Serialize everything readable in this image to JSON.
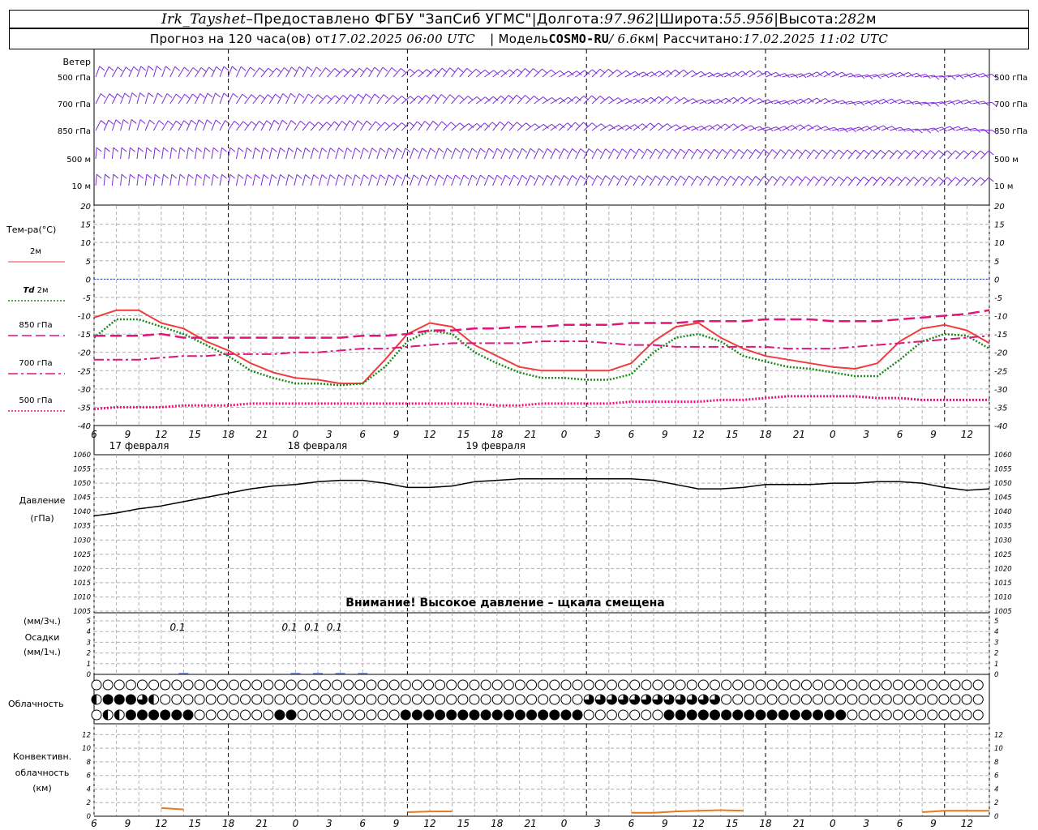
{
  "header": {
    "station": "Irk_Tayshet",
    "dash": " – ",
    "provided": "Предоставлено ФГБУ \"ЗапСиб УГМС\"",
    "sep": " | ",
    "lon_label": "Долгота: ",
    "lon": "97.962",
    "lat_label": "Широта: ",
    "lat": "55.956",
    "alt_label": "Высота: ",
    "alt": "282",
    "alt_unit": "м",
    "forecast_prefix": "Прогноз на 120 часа(ов)  от ",
    "forecast_time": "17.02.2025 06:00 UTC",
    "model_label": "| Модель ",
    "model_name": "COSMO-RU",
    "model_res": " / 6.6",
    "model_res_unit": "км",
    "calc_label": " | Рассчитано: ",
    "calc_time": "17.02.2025 11:02 UTC"
  },
  "wind_panel": {
    "title": "Ветер",
    "levels": [
      "500 гПа",
      "700 гПа",
      "850 гПа",
      "500 м",
      "10 м"
    ],
    "color": "#7a2ad8"
  },
  "temp_panel": {
    "title": "Тем-ра(°C)",
    "legend": [
      {
        "label": "2м",
        "color": "#f03c3c",
        "style": "solid"
      },
      {
        "label_italic": "Td",
        "label": " 2м",
        "color": "#1a8a1a",
        "style": "dotted"
      },
      {
        "label": "850 гПа",
        "color": "#e0147a",
        "style": "dashed"
      },
      {
        "label": "700 гПа",
        "color": "#e0147a",
        "style": "dashdot"
      },
      {
        "label": "500 гПа",
        "color": "#e0147a",
        "style": "dot"
      }
    ],
    "y_ticks": [
      "20",
      "15",
      "10",
      "5",
      "0",
      "-5",
      "-10",
      "-15",
      "-20",
      "-25",
      "-30",
      "-35",
      "-40"
    ],
    "zero_color": "#1f3fd0"
  },
  "time_axis": {
    "hour_labels": [
      "6",
      "9",
      "12",
      "15",
      "18",
      "21",
      "0",
      "3",
      "6",
      "9",
      "12",
      "15",
      "18",
      "21",
      "0",
      "3",
      "6",
      "9",
      "12",
      "15",
      "18",
      "21",
      "0",
      "3",
      "6",
      "9",
      "12"
    ],
    "day_labels": [
      "17 февраля",
      "18 февраля",
      "19 февраля"
    ]
  },
  "pressure_panel": {
    "title": "Давление",
    "unit": "(гПа)",
    "y_ticks": [
      "1060",
      "1055",
      "1050",
      "1045",
      "1040",
      "1035",
      "1030",
      "1025",
      "1020",
      "1015",
      "1010",
      "1005"
    ],
    "warning": "Внимание! Высокое давление – щкала смещена"
  },
  "precip_panel": {
    "unit3": "(мм/3ч.)",
    "title": "Осадки",
    "unit1": "(мм/1ч.)",
    "y_ticks": [
      "5",
      "4",
      "3",
      "2",
      "1",
      "0"
    ],
    "labels": [
      {
        "hour": 12,
        "text": "0.1"
      },
      {
        "hour": 27,
        "text": "0.1"
      },
      {
        "hour": 30,
        "text": "0.1"
      },
      {
        "hour": 33,
        "text": "0.1"
      }
    ]
  },
  "cloud_panel": {
    "title": "Облачность",
    "upper": "000000000000000000000000000000000000000000000000000000000000000000000000000000",
    "middle": "2444320000000000000000000000000000000000000333333333333000000000000000000000000",
    "lower": "0224444440000000440000000004444444444444444000000044444444444444440000000"
  },
  "conv_panel": {
    "title1": "Конвективн.",
    "title2": "облачность",
    "unit": "(км)",
    "y_ticks": [
      "12",
      "10",
      "8",
      "6",
      "4",
      "2",
      "0"
    ],
    "color": "#e87a1a"
  },
  "chart_data": [
    {
      "type": "line",
      "title": "Тем-ра(°C)",
      "x_unit": "hours from 17.02 06 UTC",
      "ylim": [
        -40,
        20
      ],
      "x": [
        0,
        3,
        6,
        9,
        12,
        15,
        18,
        21,
        24,
        27,
        30,
        33,
        36,
        39,
        42,
        45,
        48,
        51,
        54,
        57,
        60,
        63,
        66,
        69,
        72,
        75,
        78,
        81,
        84,
        87,
        90,
        93,
        96,
        99,
        102,
        105,
        108,
        111,
        114,
        117,
        120
      ],
      "series": [
        {
          "name": "2м",
          "values": [
            -10.5,
            -8.5,
            -8.5,
            -12,
            -13.5,
            -17,
            -19.5,
            -23,
            -25.5,
            -27,
            -27.5,
            -28.5,
            -28.5,
            -22,
            -15,
            -12,
            -13,
            -18,
            -21,
            -24,
            -25,
            -25,
            -25,
            -25,
            -23,
            -17,
            -13,
            -12,
            -16,
            -19,
            -21,
            -22,
            -23,
            -24,
            -24.5,
            -23,
            -17,
            -13.5,
            -12.5,
            -14,
            -17.5
          ]
        },
        {
          "name": "Td 2м",
          "values": [
            -16,
            -11,
            -11,
            -13,
            -15,
            -18,
            -21,
            -25,
            -27,
            -28.5,
            -28.5,
            -29,
            -28.5,
            -24,
            -17,
            -14,
            -15,
            -20,
            -23,
            -25.5,
            -27,
            -27,
            -27.5,
            -27.5,
            -26,
            -20,
            -16,
            -15,
            -17,
            -21,
            -22.5,
            -24,
            -24.5,
            -25.5,
            -26.5,
            -26.5,
            -22,
            -17,
            -15,
            -15.5,
            -19
          ]
        },
        {
          "name": "850 гПа",
          "values": [
            -15.5,
            -15.5,
            -15.5,
            -15,
            -16,
            -16,
            -16,
            -16,
            -16,
            -16,
            -16,
            -16,
            -15.5,
            -15.5,
            -15,
            -14,
            -14,
            -13.5,
            -13.5,
            -13,
            -13,
            -12.5,
            -12.5,
            -12.5,
            -12,
            -12,
            -12,
            -11.5,
            -11.5,
            -11.5,
            -11,
            -11,
            -11,
            -11.5,
            -11.5,
            -11.5,
            -11,
            -10.5,
            -10,
            -9.5,
            -8.5
          ]
        },
        {
          "name": "700 гПа",
          "values": [
            -22,
            -22,
            -22,
            -21.5,
            -21,
            -21,
            -20.5,
            -20.5,
            -20.5,
            -20,
            -20,
            -19.5,
            -19,
            -19,
            -18.5,
            -18,
            -17.5,
            -17.5,
            -17.5,
            -17.5,
            -17,
            -17,
            -17,
            -17.5,
            -18,
            -18,
            -18.5,
            -18.5,
            -18.5,
            -18.5,
            -18.5,
            -19,
            -19,
            -19,
            -18.5,
            -18,
            -17.5,
            -17,
            -16.5,
            -16,
            -15.5
          ]
        },
        {
          "name": "500 гПа",
          "values": [
            -35.5,
            -35,
            -35,
            -35,
            -34.5,
            -34.5,
            -34.5,
            -34,
            -34,
            -34,
            -34,
            -34,
            -34,
            -34,
            -34,
            -34,
            -34,
            -34,
            -34.5,
            -34.5,
            -34,
            -34,
            -34,
            -34,
            -33.5,
            -33.5,
            -33.5,
            -33.5,
            -33,
            -33,
            -32.5,
            -32,
            -32,
            -32,
            -32,
            -32.5,
            -32.5,
            -33,
            -33,
            -33,
            -33
          ]
        }
      ]
    },
    {
      "type": "line",
      "title": "Давление",
      "ylabel": "(гПа)",
      "ylim": [
        1005,
        1060
      ],
      "x": [
        0,
        3,
        6,
        9,
        12,
        15,
        18,
        21,
        24,
        27,
        30,
        33,
        36,
        39,
        42,
        45,
        48,
        51,
        54,
        57,
        60,
        63,
        66,
        69,
        72,
        75,
        78,
        81,
        84,
        87,
        90,
        93,
        96,
        99,
        102,
        105,
        108,
        111,
        114,
        117,
        120
      ],
      "values": [
        1038.5,
        1039.5,
        1041,
        1042,
        1043.5,
        1045,
        1046.5,
        1048,
        1049,
        1049.5,
        1050.5,
        1051,
        1051,
        1050,
        1048.5,
        1048.5,
        1049,
        1050.5,
        1051,
        1051.5,
        1051.5,
        1051.5,
        1051.5,
        1051.5,
        1051.5,
        1051,
        1049.5,
        1048,
        1048,
        1048.5,
        1049.5,
        1049.5,
        1049.5,
        1050,
        1050,
        1050.5,
        1050.5,
        1050,
        1048.5,
        1047.5,
        1048
      ]
    },
    {
      "type": "bar",
      "title": "Осадки",
      "ylabel": "(мм/3ч.)",
      "ylim": [
        0,
        5
      ],
      "x": [
        12,
        27,
        30,
        33,
        36
      ],
      "values": [
        0.1,
        0.1,
        0.1,
        0.1,
        0.1
      ]
    },
    {
      "type": "line",
      "title": "Конвективн. облачность",
      "ylabel": "(км)",
      "ylim": [
        0,
        13
      ],
      "segments": [
        {
          "x": [
            9,
            12
          ],
          "values": [
            1.2,
            1.0
          ]
        },
        {
          "x": [
            42,
            45,
            48
          ],
          "values": [
            0.6,
            0.7,
            0.7
          ]
        },
        {
          "x": [
            72,
            75,
            78,
            81,
            84,
            87
          ],
          "values": [
            0.5,
            0.5,
            0.7,
            0.8,
            0.9,
            0.8
          ]
        },
        {
          "x": [
            111,
            114,
            117,
            120
          ],
          "values": [
            0.6,
            0.8,
            0.8,
            0.8
          ]
        }
      ]
    }
  ]
}
